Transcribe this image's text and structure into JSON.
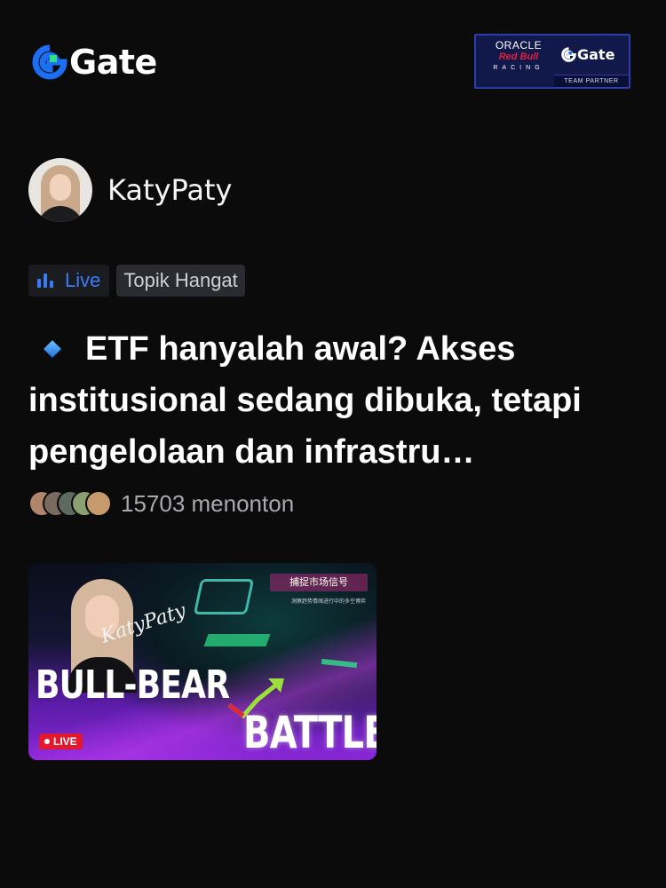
{
  "brand": {
    "name": "Gate",
    "accent": "#1c6ef2",
    "green": "#2de08a"
  },
  "partner": {
    "line1": "ORACLE",
    "line2": "Red Bull",
    "line3": "RACING",
    "brand": "Gate",
    "caption": "TEAM PARTNER"
  },
  "streamer": {
    "name": "KatyPaty"
  },
  "tags": {
    "live": "Live",
    "topic": "Topik Hangat"
  },
  "post": {
    "title": "ETF hanyalah awal? Akses institusional sedang dibuka, tetapi pengelolaan dan infrastru…"
  },
  "viewers": {
    "count_text": "15703 menonton"
  },
  "thumbnail": {
    "signature": "KatyPaty",
    "cn_title": "捕捉市场信号",
    "cn_subtitle": "洞察趋势情绪进行中的多空博弈",
    "headline1": "BULL-BEAR",
    "headline2": "BATTLE",
    "live_badge": "LIVE"
  }
}
